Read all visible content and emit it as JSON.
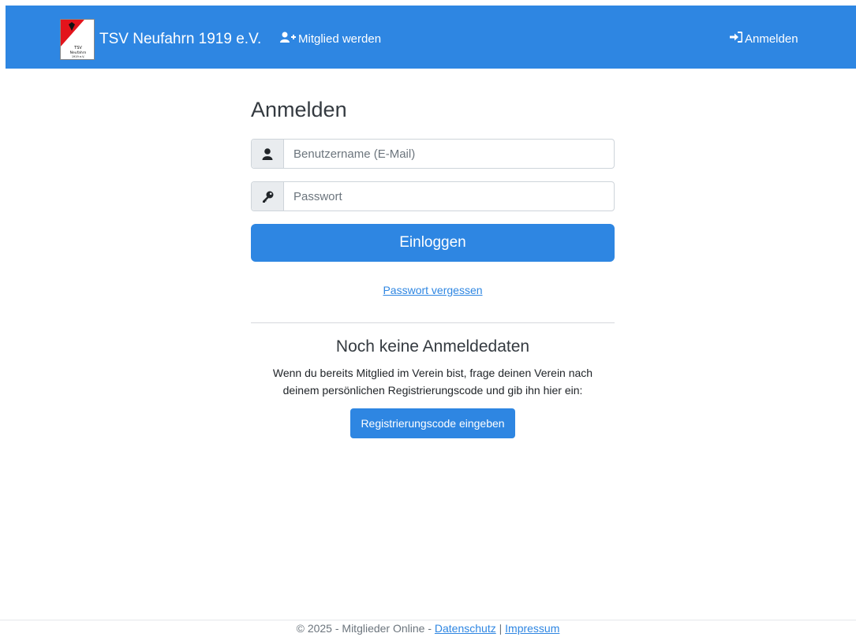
{
  "header": {
    "brand_name": "TSV Neufahrn 1919 e.V.",
    "logo_text": [
      "TSV",
      "Neufahrn",
      "1919 e.V."
    ],
    "member_link": "Mitglied werden",
    "login_link": "Anmelden",
    "bg_color": "#2e86e2"
  },
  "login": {
    "title": "Anmelden",
    "username_placeholder": "Benutzername (E-Mail)",
    "username_value": "",
    "password_placeholder": "Passwort",
    "password_value": "",
    "submit_label": "Einloggen",
    "forgot_label": "Passwort vergessen"
  },
  "register": {
    "title": "Noch keine Anmeldedaten",
    "text_line1": "Wenn du bereits Mitglied im Verein bist, frage deinen Verein nach",
    "text_line2": "deinem persönlichen Registrierungscode und gib ihn hier ein:",
    "button_label": "Registrierungscode eingeben"
  },
  "footer": {
    "copyright": "© 2025 - Mitglieder Online - ",
    "privacy": "Datenschutz",
    "separator": " | ",
    "imprint": "Impressum"
  },
  "icons": [
    "club-logo",
    "user-plus-icon",
    "sign-in-icon",
    "user-icon",
    "key-icon"
  ]
}
